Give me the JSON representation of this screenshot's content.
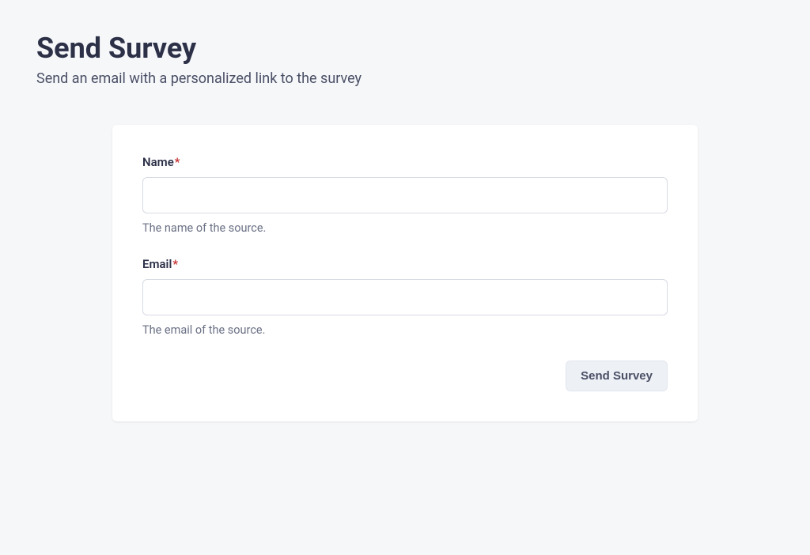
{
  "header": {
    "title": "Send Survey",
    "subtitle": "Send an email with a personalized link to the survey"
  },
  "form": {
    "name": {
      "label": "Name",
      "required_marker": "*",
      "value": "",
      "help": "The name of the source."
    },
    "email": {
      "label": "Email",
      "required_marker": "*",
      "value": "",
      "help": "The email of the source."
    },
    "submit_label": "Send Survey"
  }
}
